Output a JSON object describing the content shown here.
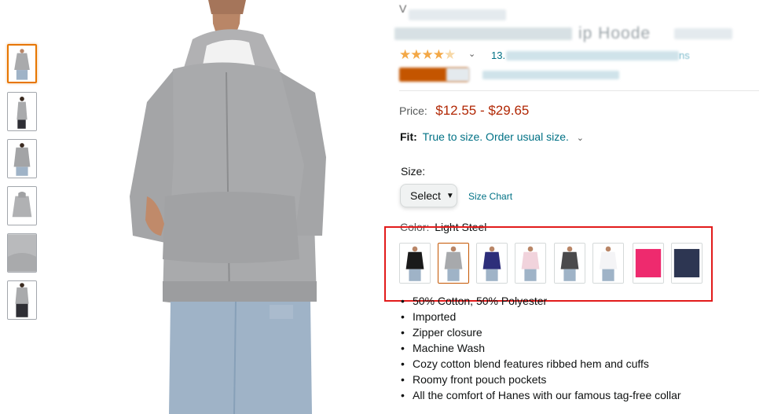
{
  "thumbnails": [
    {
      "label": "front view",
      "selected": true
    },
    {
      "label": "side view",
      "selected": false
    },
    {
      "label": "back view",
      "selected": false
    },
    {
      "label": "hoodie flat",
      "selected": false
    },
    {
      "label": "fabric detail",
      "selected": false
    },
    {
      "label": "front full",
      "selected": false
    }
  ],
  "main_image": {
    "label": "light steel zip hoodie on model"
  },
  "header": {
    "title_tail": "ip Hoode",
    "title_lead": "V",
    "ratings_lead": "13.",
    "ratings_tail": "ns",
    "stars_full": "★★★★",
    "stars_partial": "★"
  },
  "price": {
    "label": "Price:",
    "value": "$12.55 - $29.65"
  },
  "fit": {
    "label": "Fit:",
    "value": "True to size. Order usual size."
  },
  "size": {
    "label": "Size:",
    "select_label": "Select",
    "size_chart": "Size Chart"
  },
  "color": {
    "label": "Color:",
    "value": "Light Steel",
    "swatches": [
      {
        "name": "black",
        "hex": "#1a1a1a",
        "selected": false
      },
      {
        "name": "light-steel",
        "hex": "#a7a9ac",
        "selected": true
      },
      {
        "name": "navy",
        "hex": "#2d2e7a",
        "selected": false
      },
      {
        "name": "pale-pink",
        "hex": "#f1d3dc",
        "selected": false
      },
      {
        "name": "charcoal",
        "hex": "#4a4a4c",
        "selected": false
      },
      {
        "name": "white",
        "hex": "#f4f4f6",
        "selected": false
      },
      {
        "name": "pink",
        "hex": "#ee2a6e",
        "selected": false
      },
      {
        "name": "navy-heather",
        "hex": "#2d3652",
        "selected": false
      }
    ]
  },
  "bullets": [
    "50% Cotton, 50% Polyester",
    "Imported",
    "Zipper closure",
    "Machine Wash",
    "Cozy cotton blend features ribbed hem and cuffs",
    "Roomy front pouch pockets",
    "All the comfort of Hanes with our famous tag-free collar"
  ],
  "colors": {
    "link": "#007185",
    "price": "#b12704",
    "highlight": "#e21b1b",
    "star": "#f3a847",
    "selected_border": "#e77600"
  }
}
